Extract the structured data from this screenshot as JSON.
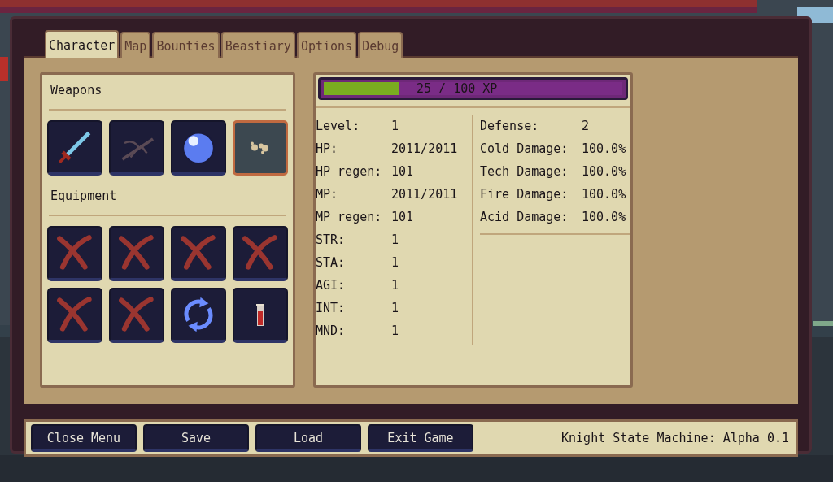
{
  "tabs": [
    {
      "label": "Character",
      "selected": true
    },
    {
      "label": "Map",
      "selected": false
    },
    {
      "label": "Bounties",
      "selected": false
    },
    {
      "label": "Beastiary",
      "selected": false
    },
    {
      "label": "Options",
      "selected": false
    },
    {
      "label": "Debug",
      "selected": false
    }
  ],
  "weapons": {
    "title": "Weapons",
    "slots": [
      {
        "kind": "sword",
        "selected": false
      },
      {
        "kind": "crossbow",
        "selected": false
      },
      {
        "kind": "orb",
        "selected": false
      },
      {
        "kind": "dust",
        "selected": true
      }
    ]
  },
  "equipment": {
    "title": "Equipment",
    "slots": [
      {
        "kind": "empty"
      },
      {
        "kind": "empty"
      },
      {
        "kind": "empty"
      },
      {
        "kind": "empty"
      },
      {
        "kind": "empty"
      },
      {
        "kind": "empty"
      },
      {
        "kind": "cycle"
      },
      {
        "kind": "potion"
      }
    ]
  },
  "xp_bar": {
    "level": 0.25,
    "reading": "25 / 100 XP"
  },
  "stats": [
    {
      "label": "Level:",
      "value": "1"
    },
    {
      "label": "HP:",
      "value": "2011/2011"
    },
    {
      "label": "HP regen:",
      "value": "101"
    },
    {
      "label": "MP:",
      "value": "2011/2011"
    },
    {
      "label": "MP regen:",
      "value": "101"
    },
    {
      "label": "STR:",
      "value": "1"
    },
    {
      "label": "STA:",
      "value": "1"
    },
    {
      "label": "AGI:",
      "value": "1"
    },
    {
      "label": "INT:",
      "value": "1"
    },
    {
      "label": "MND:",
      "value": "1"
    }
  ],
  "resistances": [
    {
      "label": "Defense:",
      "value": "2"
    },
    {
      "label": "Cold Damage:",
      "value": "100.0%"
    },
    {
      "label": "Tech Damage:",
      "value": "100.0%"
    },
    {
      "label": "Fire Damage:",
      "value": "100.0%"
    },
    {
      "label": "Acid Damage:",
      "value": "100.0%"
    }
  ],
  "buttons": [
    "Close Menu",
    "Save",
    "Load",
    "Exit Game"
  ],
  "version": "Knight State Machine: Alpha 0.1"
}
